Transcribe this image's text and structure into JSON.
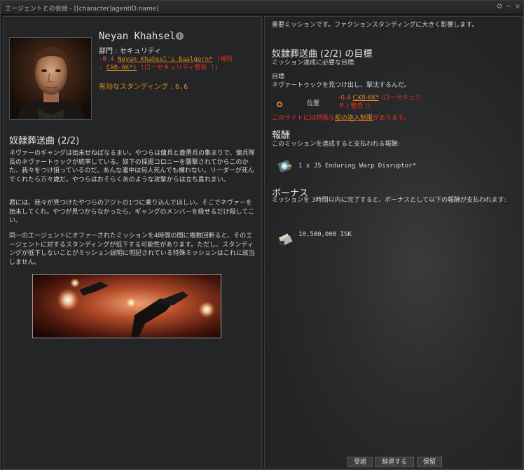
{
  "window": {
    "title": "エージェントとの会話 - [[character]agentID.name]"
  },
  "agent": {
    "name": "Neyan Khahsel",
    "division": "部門 : セキュリティ",
    "location_sec": "-0.4",
    "location_name": "Neyan Khahsel's Baalgorn*",
    "location_paren_open": "(場所",
    "location_colon": ":",
    "location_system": "CX8-6K*)",
    "location_warning": "(ローセキュリティ警告 !)",
    "standing_label": "有効なスタンディング :",
    "standing_value": "6.6"
  },
  "mission": {
    "title": "奴隷葬送曲 (2/2)",
    "paragraphs": [
      "ネヴァーのギャングは始末せねばなるまい。やつらは傭兵と義勇兵の集まりで、傭兵隊長のネヴァートゥックが統率している。奴下の採掘コロニーを襲撃されてからこのかた、我々をつけ狙っているのだ。あんな連中は何人死んでも構わない。リーダーが死んでくれたら万々歳だ。やつらはおそらくあのような攻撃からは立ち直れまい。",
      "君には、我々が見つけたやつらのアジトの1つに乗り込んでほしい。そこでネヴァーを始末してくれ。やつが見つからなかったら、ギャングのメンバーを殺せるだけ殺してこい。",
      "同一のエージェントにオファーされたミッションを4時間の間に複数回断ると、そのエージェントに対するスタンディングが低下する可能性があります。ただし、スタンディングが低下しないことがミッション説明に明記されている特殊ミッションはこれに該当しません。"
    ]
  },
  "right": {
    "importance": "重要ミッションです。ファクションスタンディングに大きく影響します。",
    "objectives_title": "奴隷葬送曲 (2/2) の目標",
    "objectives_sub": "ミッション達成に必要な目標:",
    "goal_label": "目標",
    "goal_text": "ネヴァートゥックを見つけ出し、撃沈するんだ。",
    "location_label": "位置",
    "loc_sec": "-0.4",
    "loc_system": "CX8-6K*",
    "loc_warning_1": "(ローセキュリ",
    "loc_warning_2": "ティ警告 !)",
    "restrict_pre": "このサイトには特殊な",
    "restrict_link": "船の進入制限",
    "restrict_post": "があります。",
    "reward_title": "報酬",
    "reward_sub": "このミッションを達成すると支払われる報酬:",
    "reward_item": "1 x J5 Enduring Warp Disruptor*",
    "bonus_title": "ボーナス",
    "bonus_sub": "ミッションを 3時間以内に完了すると、ボーナスとして以下の報酬が支払われます:",
    "bonus_item": "10,500,000 ISK"
  },
  "buttons": {
    "accept": "受諾",
    "decline": "辞退する",
    "defer": "保留"
  },
  "colors": {
    "security_low": "#e05a38",
    "warning_red": "#e83020",
    "orange": "#e0881a"
  }
}
